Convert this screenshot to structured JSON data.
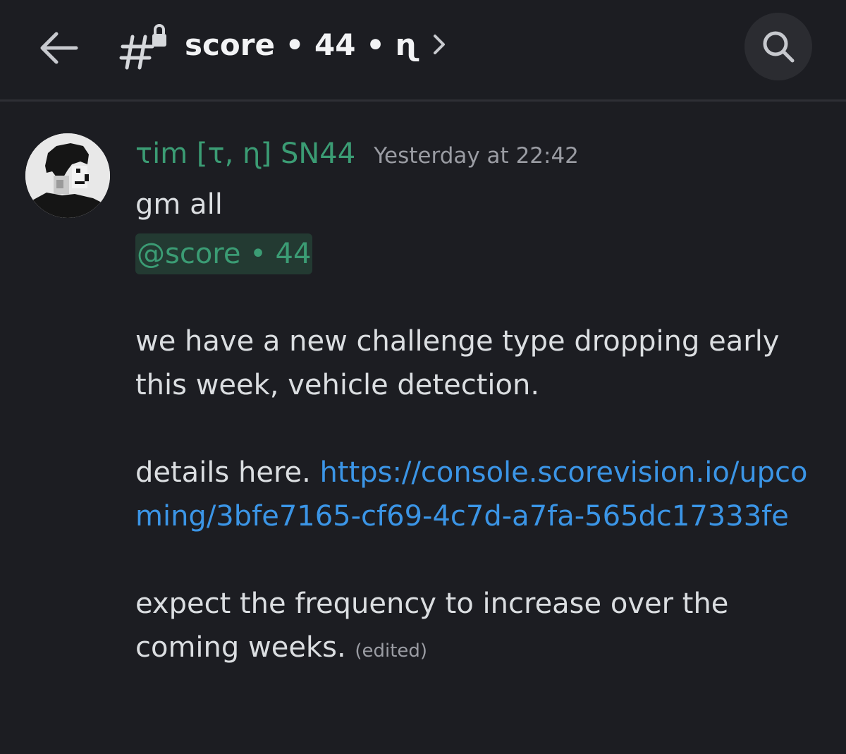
{
  "header": {
    "channel_title": "score • 44 • ɳ",
    "back_icon": "arrow-left-icon",
    "channel_icon": "locked-hashtag-icon",
    "chevron_icon": "chevron-right-icon",
    "search_icon": "search-icon"
  },
  "message": {
    "author": "τim [τ, ɳ] SN44",
    "author_color": "#3b9c74",
    "timestamp": "Yesterday at 22:42",
    "line_greeting": "gm all",
    "mention": "@score • 44",
    "para1": "we have a new challenge type dropping early this week, vehicle detection.",
    "details_prefix": "details here. ",
    "link": "https://console.scorevision.io/upcoming/3bfe7165-cf69-4c7d-a7fa-565dc17333fe",
    "link_color": "#3b95e6",
    "para3": "expect the frequency to increase over the coming weeks.",
    "edited_label": "(edited)"
  }
}
